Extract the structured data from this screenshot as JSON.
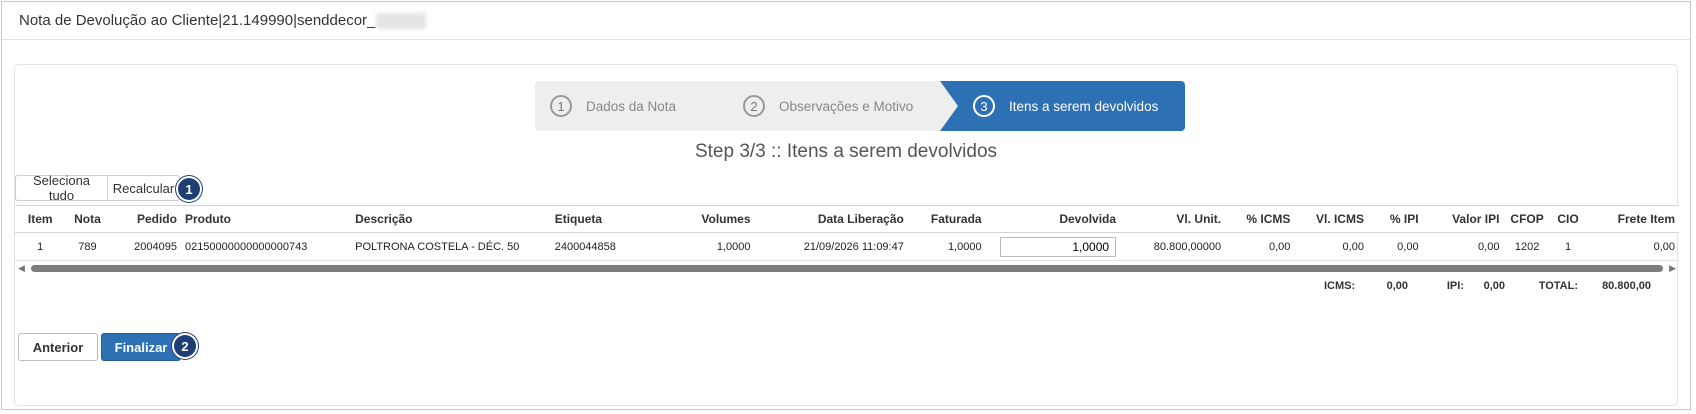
{
  "window": {
    "title": "Nota de Devolução ao Cliente|21.149990|senddecor_"
  },
  "wizard": {
    "steps": [
      {
        "number": "1",
        "label": "Dados da Nota"
      },
      {
        "number": "2",
        "label": "Observações e Motivo"
      },
      {
        "number": "3",
        "label": "Itens a serem devolvidos"
      }
    ],
    "active_step": 3,
    "heading": "Step 3/3 :: Itens a serem devolvidos"
  },
  "toolbar": {
    "select_all_label": "Seleciona tudo",
    "recalc_label": "Recalcular",
    "badge": "1"
  },
  "table": {
    "columns": [
      "Item",
      "Nota",
      "Pedido",
      "Produto",
      "Descrição",
      "Etiqueta",
      "Volumes",
      "Data Liberação",
      "Faturada",
      "Devolvida",
      "Vl. Unit.",
      "% ICMS",
      "Vl. ICMS",
      "% IPI",
      "Valor IPI",
      "CFOP",
      "CIO",
      "Frete Item"
    ],
    "rows": [
      {
        "item": "1",
        "nota": "789",
        "pedido": "2004095",
        "produto": "02150000000000000743",
        "descricao": "POLTRONA COSTELA - DÉC. 50",
        "etiqueta": "2400044858",
        "volumes": "1,0000",
        "data_liberacao": "21/09/2026 11:09:47",
        "faturada": "1,0000",
        "devolvida": "1,0000",
        "vl_unit": "80.800,00000",
        "pct_icms": "0,00",
        "vl_icms": "0,00",
        "pct_ipi": "0,00",
        "valor_ipi": "0,00",
        "cfop": "1202",
        "cio": "1",
        "frete_item": "0,00"
      }
    ]
  },
  "totals": {
    "icms_label": "ICMS:",
    "icms_value": "0,00",
    "ipi_label": "IPI:",
    "ipi_value": "0,00",
    "total_label": "TOTAL:",
    "total_value": "80.800,00"
  },
  "footer": {
    "previous_label": "Anterior",
    "finish_label": "Finalizar",
    "badge": "2"
  },
  "colors": {
    "primary": "#2d70b3",
    "badge": "#1f3f74",
    "inactive_step": "#eeeeee"
  }
}
